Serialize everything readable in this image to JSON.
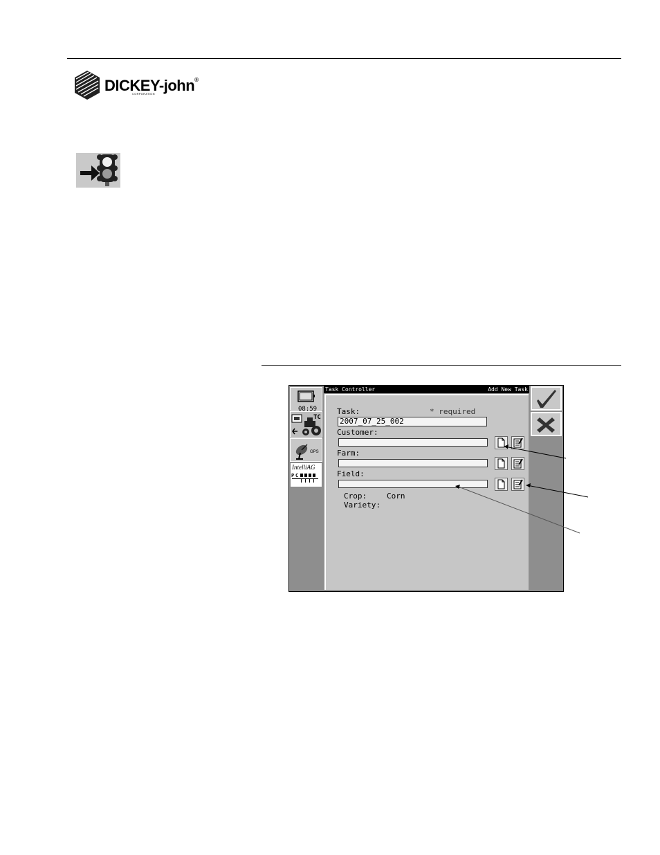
{
  "company": {
    "name": "DICKEY-john",
    "registered": "®",
    "sub": "CORPORATION"
  },
  "screen": {
    "title_left": "Task Controller",
    "title_right": "Add New Task",
    "clock": "08:59",
    "gps_label": "GPS",
    "brand_label": "IntelliAG",
    "form": {
      "task_label": "Task:",
      "required_note": "* required",
      "task_value": "2007_07_25_002",
      "customer_label": "Customer:",
      "customer_value": "",
      "farm_label": "Farm:",
      "farm_value": "",
      "field_label": "Field:",
      "field_value": "",
      "crop_label": "Crop:",
      "crop_value": "Corn",
      "variety_label": "Variety:",
      "variety_value": ""
    },
    "icons": {
      "accept": "checkmark-icon",
      "cancel": "x-icon",
      "new": "new-document-icon",
      "edit": "edit-document-icon"
    }
  }
}
